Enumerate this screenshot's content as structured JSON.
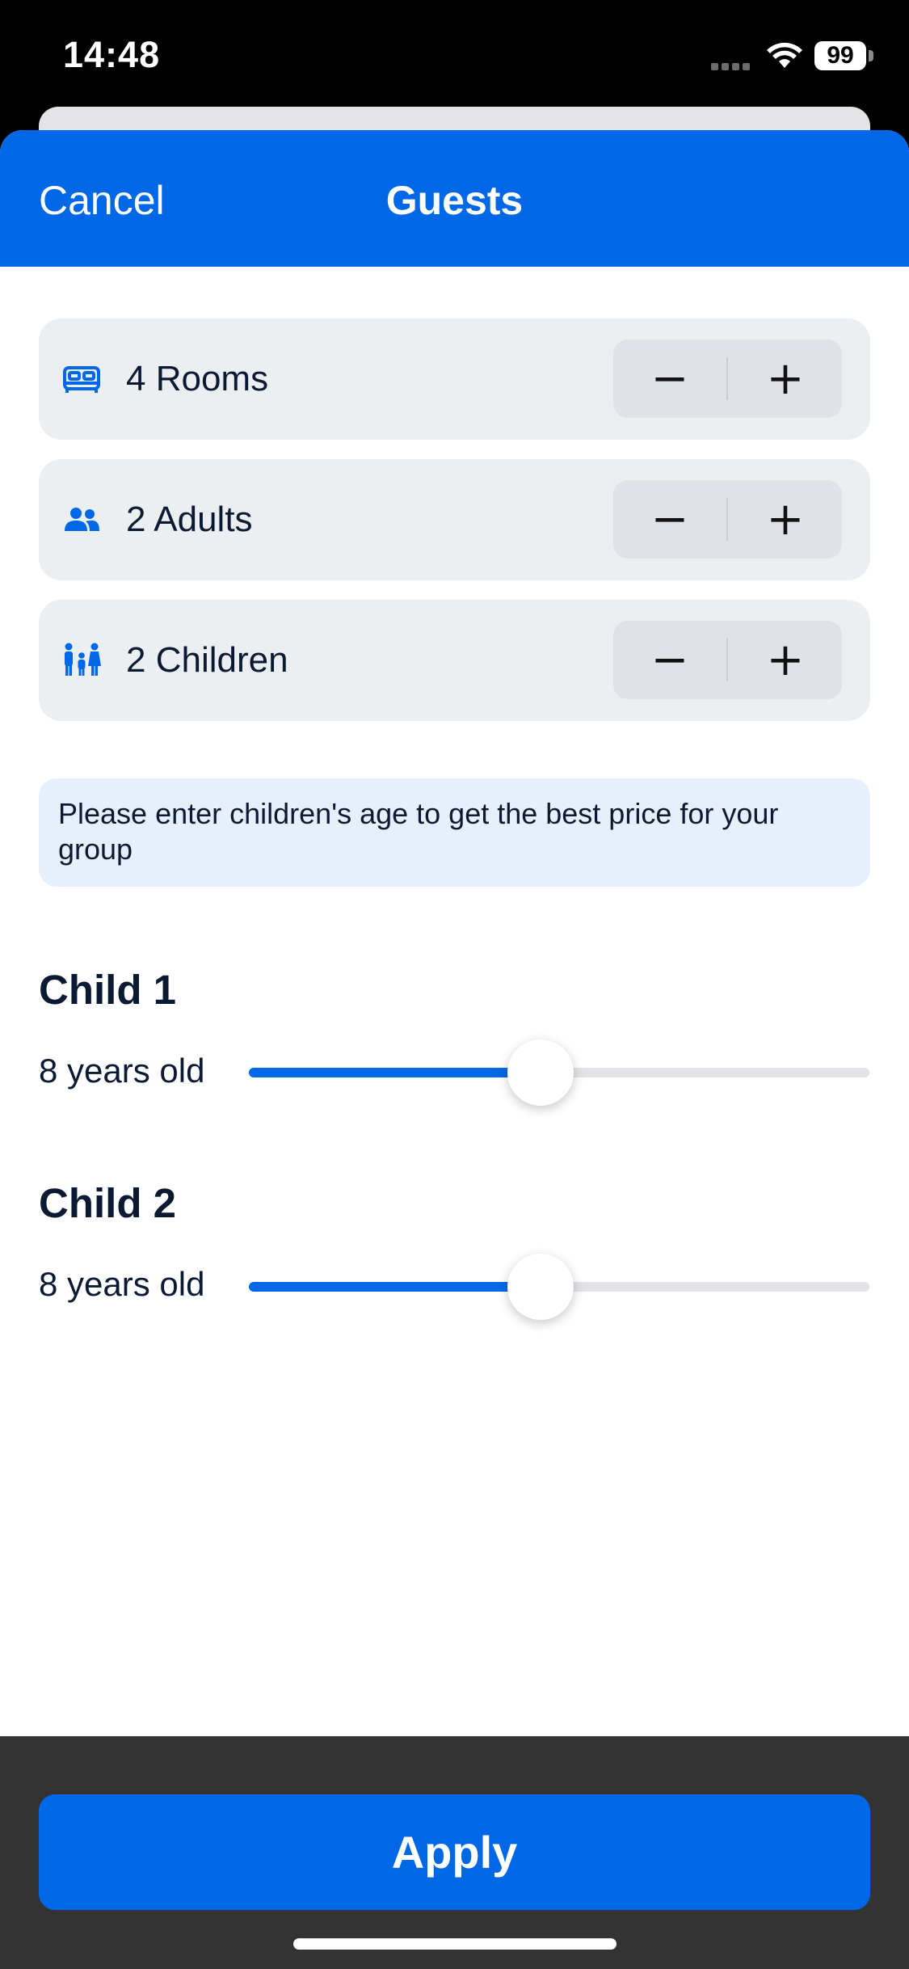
{
  "status_bar": {
    "time": "14:48",
    "battery": "99"
  },
  "header": {
    "cancel_label": "Cancel",
    "title": "Guests"
  },
  "steppers": [
    {
      "label": "4 Rooms",
      "icon": "bed-icon"
    },
    {
      "label": "2 Adults",
      "icon": "people-icon"
    },
    {
      "label": "2 Children",
      "icon": "family-icon"
    }
  ],
  "stepper_symbols": {
    "minus": "−",
    "plus": "+"
  },
  "info_text": "Please enter children's age to get the best price for your group",
  "children": [
    {
      "title": "Child 1",
      "age_label": "8 years old",
      "age_fraction": 0.47
    },
    {
      "title": "Child 2",
      "age_label": "8 years old",
      "age_fraction": 0.47
    }
  ],
  "footer": {
    "apply_label": "Apply"
  },
  "colors": {
    "accent": "#0068e6",
    "text": "#0b1a33",
    "row_bg": "#eceff2",
    "info_bg": "#e6f0fc"
  }
}
